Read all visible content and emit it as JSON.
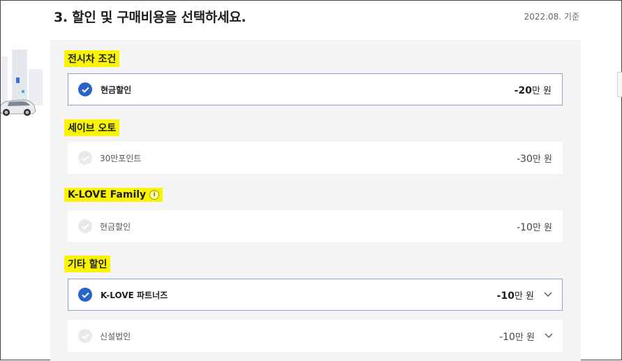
{
  "section": {
    "title": "3. 할인 및 구매비용을 선택하세요.",
    "date_note": "2022.08. 기준"
  },
  "groups": [
    {
      "label": "전시차 조건",
      "options": [
        {
          "label": "현금할인",
          "amount_num": "-20",
          "amount_unit": "만 원",
          "selected": true
        }
      ]
    },
    {
      "label": "세이브 오토",
      "options": [
        {
          "label": "30만포인트",
          "amount_num": "-30",
          "amount_unit": "만 원",
          "selected": false
        }
      ]
    },
    {
      "label": "K-LOVE Family",
      "info_icon": "info-icon",
      "options": [
        {
          "label": "현금할인",
          "amount_num": "-10",
          "amount_unit": "만 원",
          "selected": false
        }
      ]
    },
    {
      "label": "기타 할인",
      "options": [
        {
          "label": "K-LOVE 파트너즈",
          "amount_num": "-10",
          "amount_unit": "만 원",
          "selected": true,
          "expandable": true
        },
        {
          "label": "신설법인",
          "amount_num": "-10",
          "amount_unit": "만 원",
          "selected": false,
          "expandable": true
        }
      ]
    }
  ],
  "colors": {
    "highlight": "#fbf400",
    "check_selected": "#2a63c6",
    "check_unselected": "#e9e9e9",
    "selected_border": "#8aa4cf",
    "panel_bg": "#f4f4f4"
  }
}
